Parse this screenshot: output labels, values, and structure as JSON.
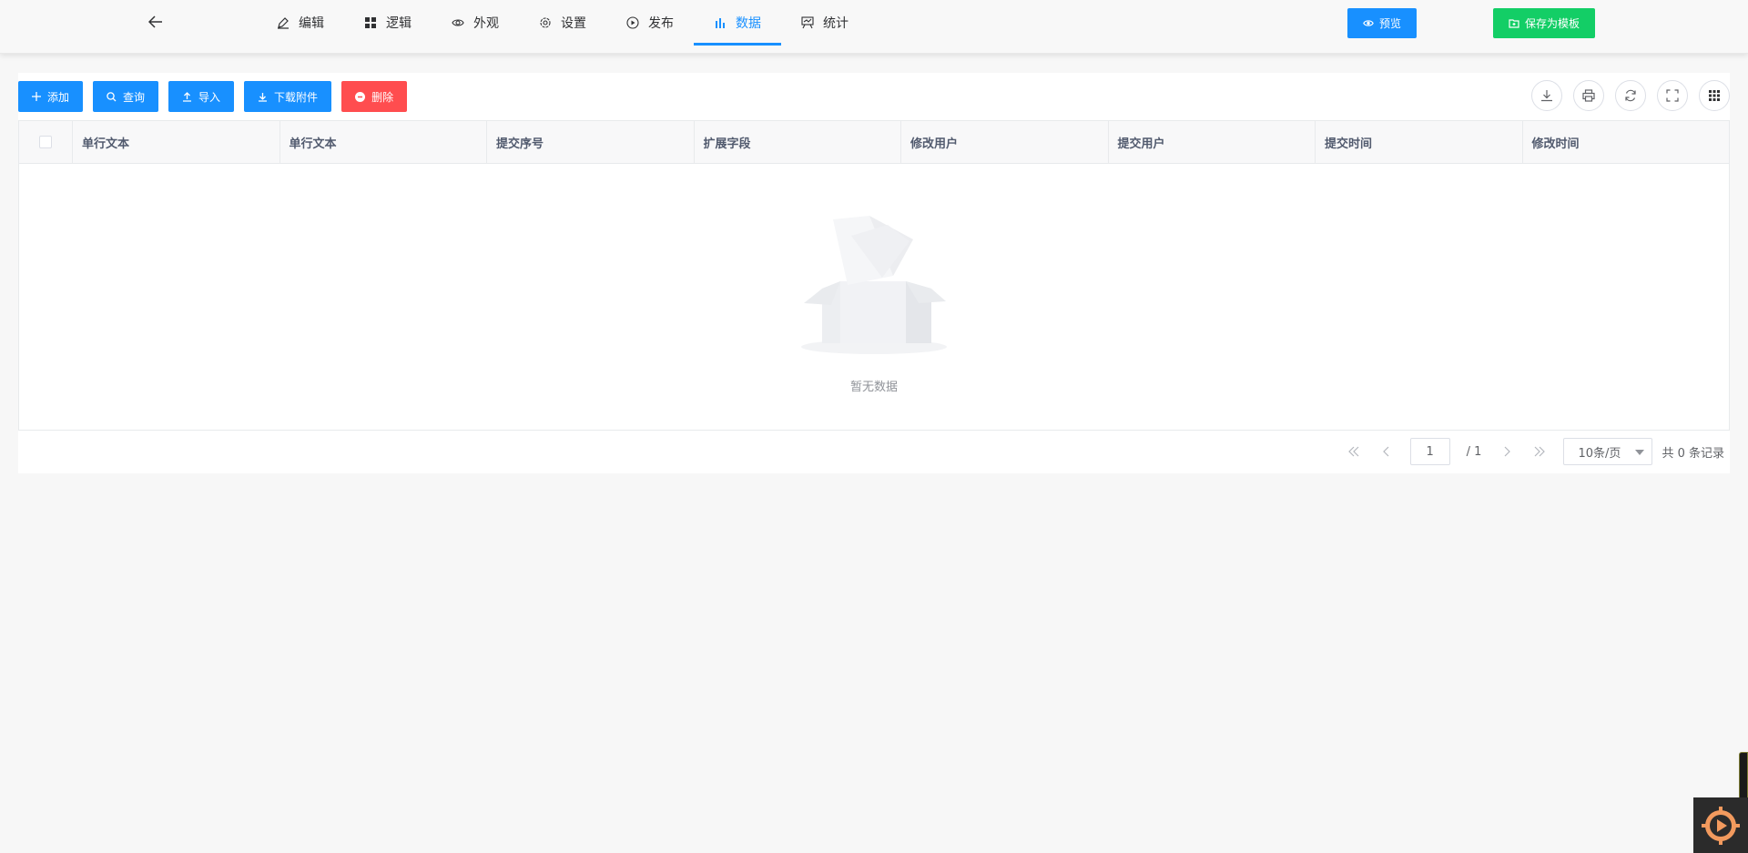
{
  "header": {
    "back_icon": "arrow-left-icon",
    "nav": [
      {
        "label": "编辑",
        "icon": "edit-icon"
      },
      {
        "label": "逻辑",
        "icon": "grid-icon"
      },
      {
        "label": "外观",
        "icon": "eye-icon"
      },
      {
        "label": "设置",
        "icon": "gear-icon"
      },
      {
        "label": "发布",
        "icon": "play-icon"
      },
      {
        "label": "数据",
        "icon": "bar-chart-icon",
        "active": true
      },
      {
        "label": "统计",
        "icon": "stats-board-icon"
      }
    ],
    "preview_label": "预览",
    "save_template_label": "保存为模板"
  },
  "toolbar": {
    "add_label": "添加",
    "query_label": "查询",
    "import_label": "导入",
    "download_label": "下载附件",
    "delete_label": "删除"
  },
  "tools": [
    "download-icon",
    "print-icon",
    "refresh-icon",
    "fullscreen-icon",
    "columns-icon"
  ],
  "table": {
    "columns": [
      "单行文本",
      "单行文本",
      "提交序号",
      "扩展字段",
      "修改用户",
      "提交用户",
      "提交时间",
      "修改时间"
    ],
    "rows": [],
    "empty_text": "暂无数据"
  },
  "pager": {
    "current_page": "1",
    "total_pages": "/ 1",
    "page_size": "10条/页",
    "total": "共 0 条记录"
  },
  "colors": {
    "primary": "#1890ff",
    "success": "#13ce66",
    "danger": "#ff4d4f"
  }
}
